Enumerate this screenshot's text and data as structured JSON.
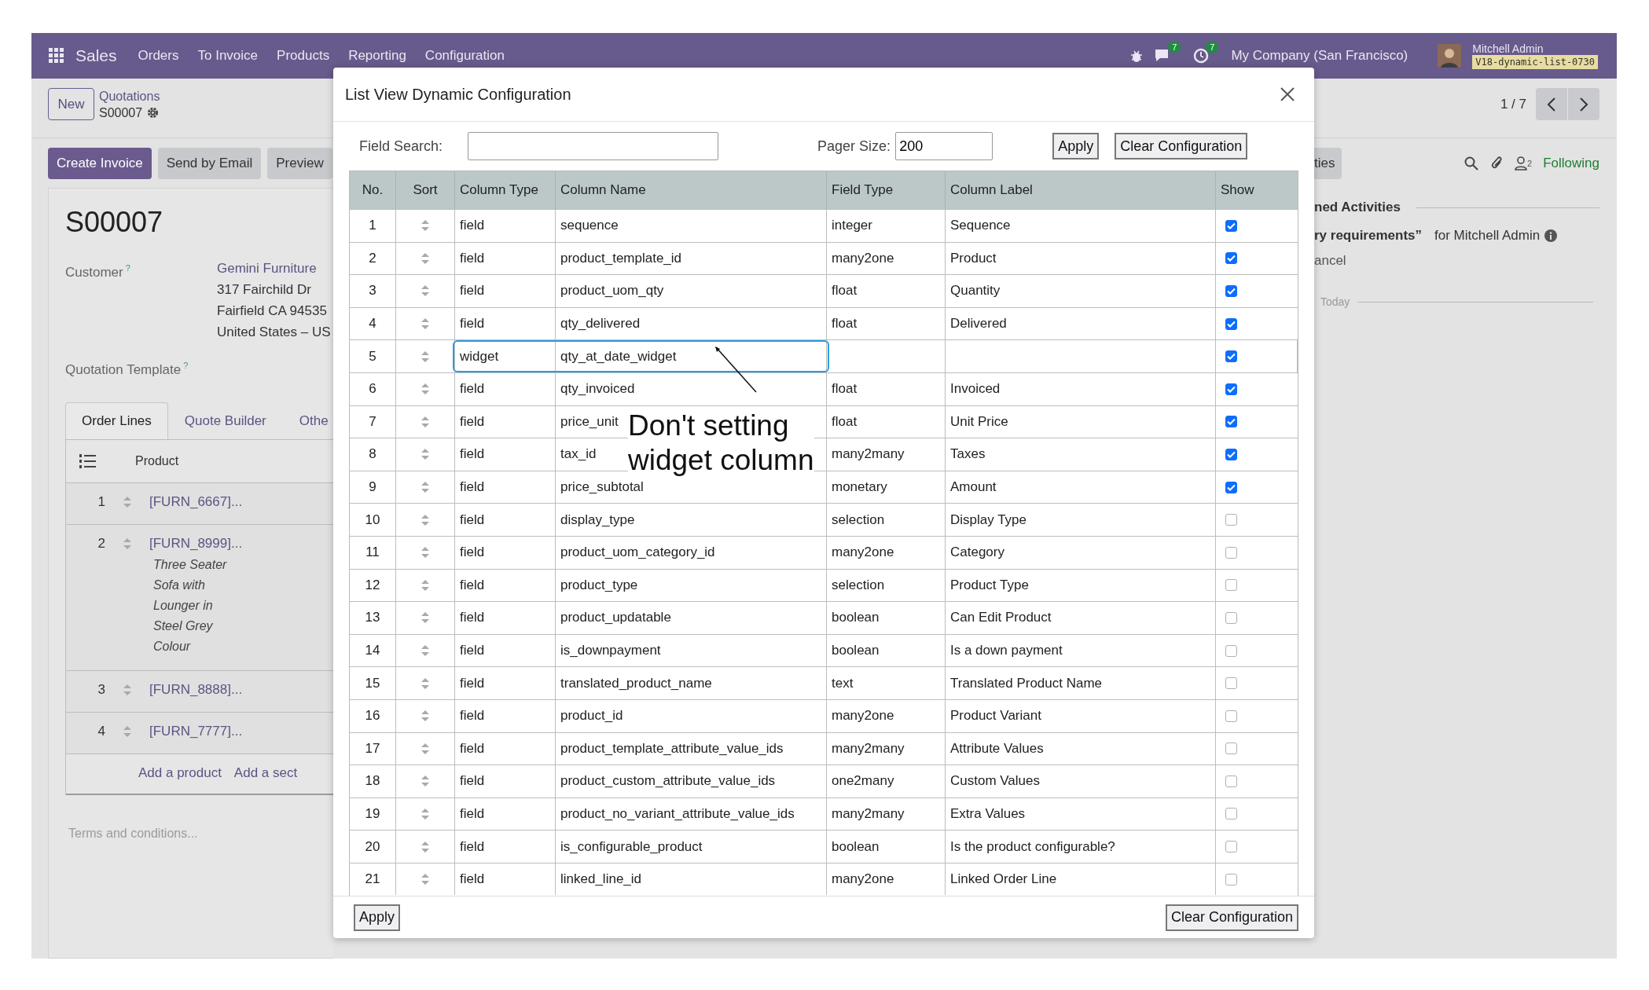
{
  "navbar": {
    "app": "Sales",
    "menu": [
      "Orders",
      "To Invoice",
      "Products",
      "Reporting",
      "Configuration"
    ],
    "chat_badge": "7",
    "activity_badge": "7",
    "company": "My Company (San Francisco)",
    "user": "Mitchell Admin",
    "database": "V18-dynamic-list-0730"
  },
  "control_panel": {
    "new_button": "New",
    "breadcrumb": "Quotations",
    "record": "S00007",
    "pager": "1 / 7"
  },
  "actions": [
    {
      "label": "Create Invoice",
      "primary": true
    },
    {
      "label": "Send by Email",
      "primary": false
    },
    {
      "label": "Preview",
      "primary": false
    }
  ],
  "form": {
    "title": "S00007",
    "fields": [
      {
        "label": "Customer",
        "help": "?"
      },
      {
        "label": "Quotation Template",
        "help": "?"
      }
    ],
    "customer": {
      "name": "Gemini Furniture",
      "address": [
        "317 Fairchild Dr",
        "Fairfield CA 94535",
        "United States – US"
      ]
    },
    "tabs": [
      {
        "label": "Order Lines",
        "selected": true
      },
      {
        "label": "Quote Builder",
        "selected": false
      },
      {
        "label": "Othe",
        "selected": false
      }
    ],
    "lines_header": "Product",
    "lines": [
      {
        "no": "1",
        "product": "[FURN_6667]..."
      },
      {
        "no": "2",
        "product": "[FURN_8999]...",
        "description": [
          "Three Seater",
          "Sofa with",
          "Lounger in",
          "Steel Grey",
          "Colour"
        ]
      },
      {
        "no": "3",
        "product": "[FURN_8888]..."
      },
      {
        "no": "4",
        "product": "[FURN_7777]..."
      }
    ],
    "add_links": [
      "Add a product",
      "Add a sect"
    ],
    "terms_placeholder": "Terms and conditions..."
  },
  "chatter": {
    "tab": "ties",
    "followers": "2",
    "following": "Following",
    "section": "ned Activities",
    "activity_title": "ry requirements”",
    "activity_user": "for Mitchell Admin",
    "activity_action": "ancel",
    "today": "Today"
  },
  "dialog": {
    "title": "List View Dynamic Configuration",
    "search_label": "Field Search:",
    "pager_label": "Pager Size:",
    "pager_value": "200",
    "apply": "Apply",
    "clear": "Clear Configuration",
    "columns": [
      "No.",
      "Sort",
      "Column Type",
      "Column Name",
      "Field Type",
      "Column Label",
      "Show"
    ],
    "rows": [
      {
        "no": "1",
        "type": "field",
        "name": "sequence",
        "field_type": "integer",
        "label": "Sequence",
        "show": true,
        "highlighted": false
      },
      {
        "no": "2",
        "type": "field",
        "name": "product_template_id",
        "field_type": "many2one",
        "label": "Product",
        "show": true,
        "highlighted": false
      },
      {
        "no": "3",
        "type": "field",
        "name": "product_uom_qty",
        "field_type": "float",
        "label": "Quantity",
        "show": true,
        "highlighted": false
      },
      {
        "no": "4",
        "type": "field",
        "name": "qty_delivered",
        "field_type": "float",
        "label": "Delivered",
        "show": true,
        "highlighted": false
      },
      {
        "no": "5",
        "type": "widget",
        "name": "qty_at_date_widget",
        "show": true,
        "highlighted": true
      },
      {
        "no": "6",
        "type": "field",
        "name": "qty_invoiced",
        "field_type": "float",
        "label": "Invoiced",
        "show": true,
        "highlighted": false
      },
      {
        "no": "7",
        "type": "field",
        "name": "price_unit",
        "field_type": "float",
        "label": "Unit Price",
        "show": true,
        "highlighted": false
      },
      {
        "no": "8",
        "type": "field",
        "name": "tax_id",
        "field_type": "many2many",
        "label": "Taxes",
        "show": true,
        "highlighted": false
      },
      {
        "no": "9",
        "type": "field",
        "name": "price_subtotal",
        "field_type": "monetary",
        "label": "Amount",
        "show": true,
        "highlighted": false
      },
      {
        "no": "10",
        "type": "field",
        "name": "display_type",
        "field_type": "selection",
        "label": "Display Type",
        "show": false,
        "highlighted": false
      },
      {
        "no": "11",
        "type": "field",
        "name": "product_uom_category_id",
        "field_type": "many2one",
        "label": "Category",
        "show": false,
        "highlighted": false
      },
      {
        "no": "12",
        "type": "field",
        "name": "product_type",
        "field_type": "selection",
        "label": "Product Type",
        "show": false,
        "highlighted": false
      },
      {
        "no": "13",
        "type": "field",
        "name": "product_updatable",
        "field_type": "boolean",
        "label": "Can Edit Product",
        "show": false,
        "highlighted": false
      },
      {
        "no": "14",
        "type": "field",
        "name": "is_downpayment",
        "field_type": "boolean",
        "label": "Is a down payment",
        "show": false,
        "highlighted": false
      },
      {
        "no": "15",
        "type": "field",
        "name": "translated_product_name",
        "field_type": "text",
        "label": "Translated Product Name",
        "show": false,
        "highlighted": false
      },
      {
        "no": "16",
        "type": "field",
        "name": "product_id",
        "field_type": "many2one",
        "label": "Product Variant",
        "show": false,
        "highlighted": false
      },
      {
        "no": "17",
        "type": "field",
        "name": "product_template_attribute_value_ids",
        "field_type": "many2many",
        "label": "Attribute Values",
        "show": false,
        "highlighted": false
      },
      {
        "no": "18",
        "type": "field",
        "name": "product_custom_attribute_value_ids",
        "field_type": "one2many",
        "label": "Custom Values",
        "show": false,
        "highlighted": false
      },
      {
        "no": "19",
        "type": "field",
        "name": "product_no_variant_attribute_value_ids",
        "field_type": "many2many",
        "label": "Extra Values",
        "show": false,
        "highlighted": false
      },
      {
        "no": "20",
        "type": "field",
        "name": "is_configurable_product",
        "field_type": "boolean",
        "label": "Is the product configurable?",
        "show": false,
        "highlighted": false
      },
      {
        "no": "21",
        "type": "field",
        "name": "linked_line_id",
        "field_type": "many2one",
        "label": "Linked Order Line",
        "show": false,
        "highlighted": false
      }
    ],
    "footer_apply": "Apply",
    "footer_clear": "Clear Configuration",
    "annotation": [
      "Don't setting",
      "widget column"
    ]
  }
}
